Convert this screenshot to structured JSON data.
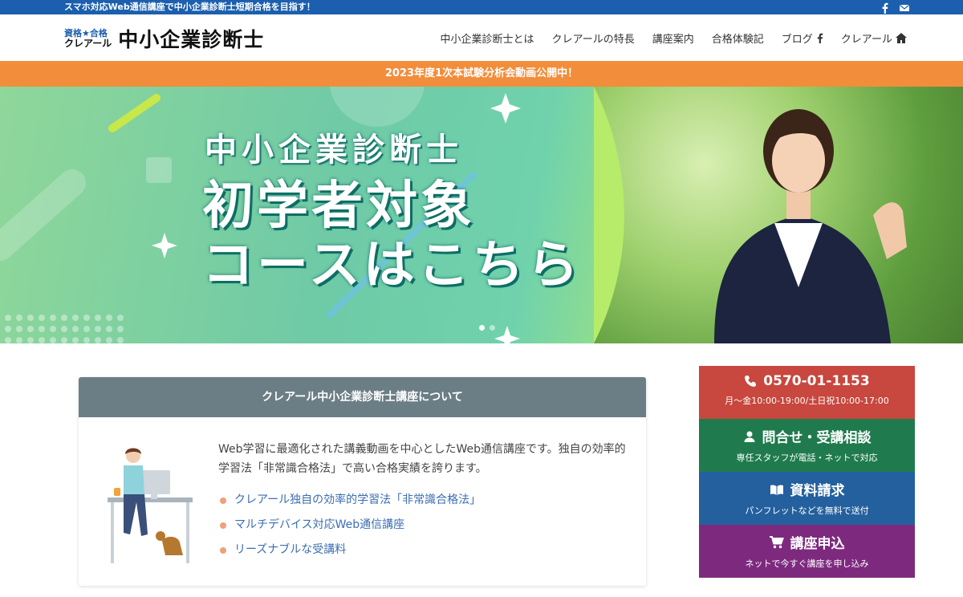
{
  "topbar": {
    "tagline": "スマホ対応Web通信講座で中小企業診断士短期合格を目指す！",
    "icons": [
      "facebook-icon",
      "mail-icon"
    ]
  },
  "logo": {
    "small_line1": "資格★合格",
    "small_line2": "クレアール",
    "main": "中小企業診断士"
  },
  "nav": [
    {
      "label": "中小企業診断士とは"
    },
    {
      "label": "クレアールの特長"
    },
    {
      "label": "講座案内"
    },
    {
      "label": "合格体験記"
    },
    {
      "label": "ブログ",
      "icon": "facebook-icon"
    },
    {
      "label": "クレアール",
      "icon": "home-icon"
    }
  ],
  "announcement": "2023年度1次本試験分析会動画公開中！",
  "hero": {
    "title1": "中小企業診断士",
    "title2_line1": "初学者対象",
    "title2_line2": "コースはこちら",
    "active_slide": 1,
    "slide_count": 2
  },
  "about": {
    "heading": "クレアール中小企業診断士講座について",
    "description": "Web学習に最適化された講義動画を中心としたWeb通信講座です。独自の効率的学習法「非常識合格法」で高い合格実績を誇ります。",
    "features": [
      "クレアール独自の効率的学習法「非常識合格法」",
      "マルチデバイス対応Web通信講座",
      "リーズナブルな受講料"
    ]
  },
  "sidebar": {
    "tel": {
      "title": "0570-01-1153",
      "sub": "月〜金10:00-19:00/土日祝10:00-17:00",
      "icon": "phone-icon"
    },
    "contact": {
      "title": "問合せ・受講相談",
      "sub": "専任スタッフが電話・ネットで対応",
      "icon": "person-icon"
    },
    "document": {
      "title": "資料請求",
      "sub": "パンフレットなどを無料で送付",
      "icon": "book-icon"
    },
    "apply": {
      "title": "講座申込",
      "sub": "ネットで今すぐ講座を申し込み",
      "icon": "cart-icon"
    }
  },
  "colors": {
    "topbar": "#1b5fae",
    "announce": "#f28d3b",
    "about_head": "#6b7e85",
    "cta_tel": "#c8473e",
    "cta_contact": "#1f7b4d",
    "cta_doc": "#24609e",
    "cta_apply": "#7d2a7e"
  }
}
